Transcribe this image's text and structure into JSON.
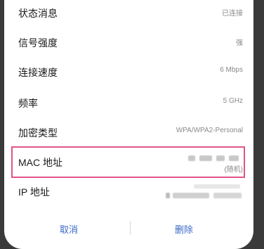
{
  "rows": [
    {
      "label": "状态消息",
      "value": "已连接"
    },
    {
      "label": "信号强度",
      "value": "强"
    },
    {
      "label": "连接速度",
      "value": "6 Mbps"
    },
    {
      "label": "频率",
      "value": "5 GHz"
    },
    {
      "label": "加密类型",
      "value": "WPA/WPA2-Personal"
    },
    {
      "label": "MAC 地址",
      "value_note": "(随机)"
    },
    {
      "label": "IP 地址"
    }
  ],
  "buttons": {
    "cancel": "取消",
    "delete": "删除"
  },
  "colors": {
    "accent": "#3a68c8",
    "highlight_border": "#e0548a"
  }
}
